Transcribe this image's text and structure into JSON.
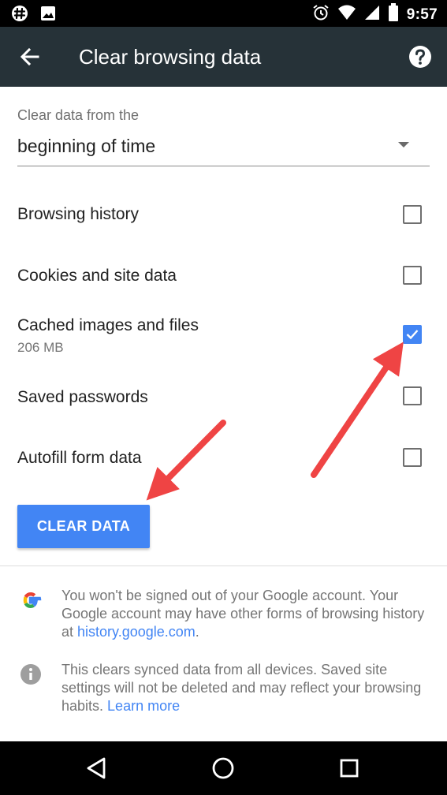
{
  "status_bar": {
    "time": "9:57",
    "left_icons": [
      "slack-icon",
      "image-icon"
    ],
    "right_icons": [
      "alarm-icon",
      "wifi-icon",
      "signal-icon",
      "battery-icon"
    ]
  },
  "app_bar": {
    "title": "Clear browsing data",
    "back_icon": "back-arrow-icon",
    "help_icon": "help-icon"
  },
  "range": {
    "label": "Clear data from the",
    "value": "beginning of time"
  },
  "options": [
    {
      "label": "Browsing history",
      "sub": "",
      "checked": false
    },
    {
      "label": "Cookies and site data",
      "sub": "",
      "checked": false
    },
    {
      "label": "Cached images and files",
      "sub": "206 MB",
      "checked": true
    },
    {
      "label": "Saved passwords",
      "sub": "",
      "checked": false
    },
    {
      "label": "Autofill form data",
      "sub": "",
      "checked": false
    }
  ],
  "clear_button": {
    "label": "CLEAR DATA"
  },
  "info": [
    {
      "icon": "google-logo-icon",
      "text": "You won't be signed out of your Google account. Your Google account may have other forms of browsing history at ",
      "link": "history.google.com",
      "suffix": "."
    },
    {
      "icon": "info-icon",
      "text": "This clears synced data from all devices. Saved site settings will not be deleted and may reflect your browsing habits. ",
      "link": "Learn more",
      "suffix": ""
    }
  ],
  "nav_bar": {
    "icons": [
      "back-triangle-icon",
      "home-circle-icon",
      "recents-square-icon"
    ]
  },
  "colors": {
    "app_bar": "#263238",
    "accent": "#4285f4",
    "annotation_arrow": "#ef4444"
  }
}
